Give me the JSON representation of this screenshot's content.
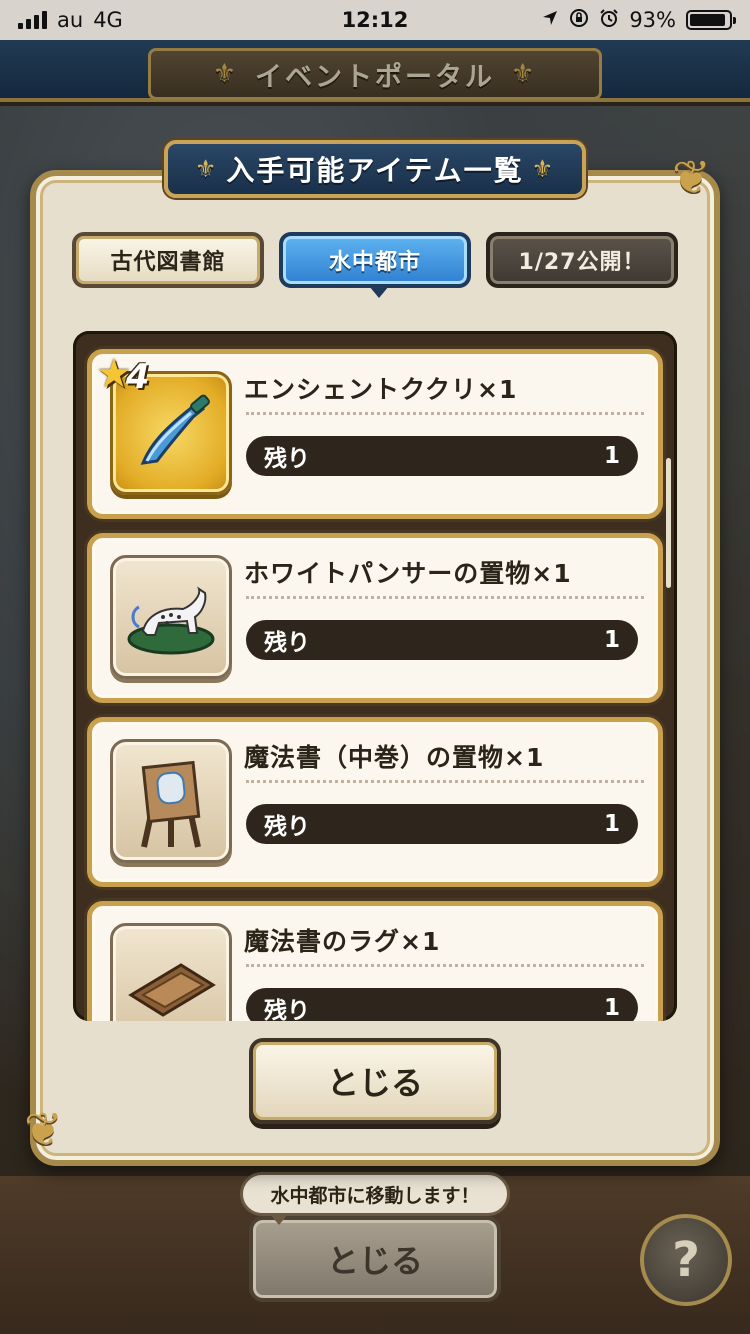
{
  "status_bar": {
    "carrier": "au",
    "network": "4G",
    "time": "12:12",
    "battery": "93%",
    "battery_level": 0.93
  },
  "background": {
    "screen_title": "イベントポータル",
    "close_label": "とじる",
    "tooltip": "水中都市に移動します！",
    "help_label": "?"
  },
  "dialog": {
    "title": "入手可能アイテム一覧",
    "tabs": [
      {
        "label": "古代図書館",
        "state": "default"
      },
      {
        "label": "水中都市",
        "state": "selected"
      },
      {
        "label": "1/27公開！",
        "state": "disabled"
      }
    ],
    "remaining_label": "残り",
    "items": [
      {
        "name": "エンシェントククリ×1",
        "remaining": "1",
        "rarity": "4",
        "icon": "kukri-dagger-icon"
      },
      {
        "name": "ホワイトパンサーの置物×1",
        "remaining": "1",
        "icon": "white-panther-figure-icon"
      },
      {
        "name": "魔法書（中巻）の置物×1",
        "remaining": "1",
        "icon": "spellbook-easel-icon"
      },
      {
        "name": "魔法書のラグ×1",
        "remaining": "1",
        "icon": "spellbook-rug-icon"
      }
    ],
    "close_label": "とじる"
  },
  "colors": {
    "accent_gold": "#c9a04e",
    "tab_selected": "#2f7fd0",
    "title_navy": "#1c3652"
  }
}
